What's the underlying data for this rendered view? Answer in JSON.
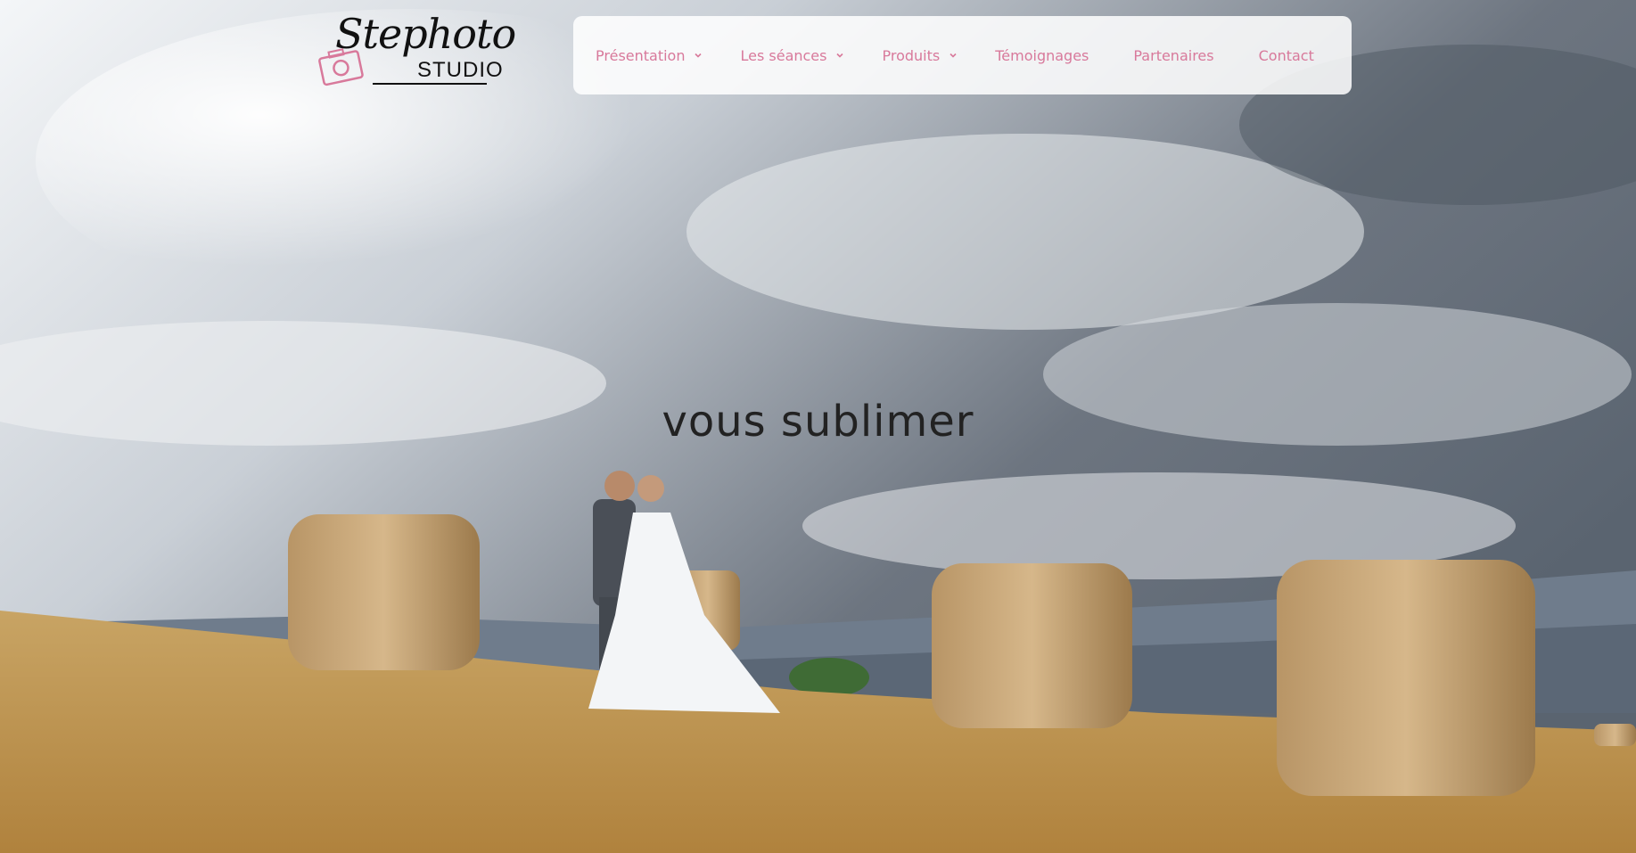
{
  "logo": {
    "script_text": "Stephoto",
    "studio_text": "STUDIO"
  },
  "nav": {
    "items": [
      {
        "label": "Présentation",
        "has_dropdown": true
      },
      {
        "label": "Les séances",
        "has_dropdown": true
      },
      {
        "label": "Produits",
        "has_dropdown": true
      },
      {
        "label": "Témoignages",
        "has_dropdown": false
      },
      {
        "label": "Partenaires",
        "has_dropdown": false
      },
      {
        "label": "Contact",
        "has_dropdown": false
      }
    ],
    "text_color": "#d8799b"
  },
  "hero": {
    "tagline": "vous sublimer",
    "image_icon": "wedding-couple-hay-field-photo"
  }
}
